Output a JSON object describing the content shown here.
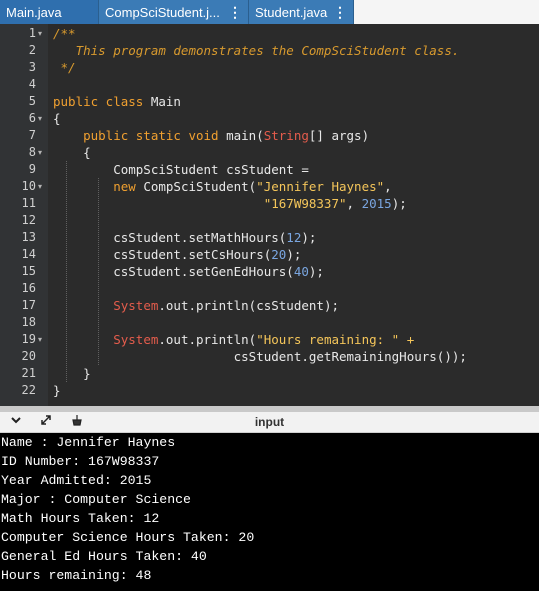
{
  "tabs": [
    {
      "label": "Main.java",
      "active": true
    },
    {
      "label": "CompSciStudent.j...",
      "menu": "⋮"
    },
    {
      "label": "Student.java",
      "menu": "⋮"
    }
  ],
  "editor": {
    "lines": [
      {
        "n": "1",
        "fold": "▾"
      },
      {
        "n": "2"
      },
      {
        "n": "3"
      },
      {
        "n": "4"
      },
      {
        "n": "5"
      },
      {
        "n": "6",
        "fold": "▾"
      },
      {
        "n": "7"
      },
      {
        "n": "8",
        "fold": "▾"
      },
      {
        "n": "9"
      },
      {
        "n": "10",
        "fold": "▾"
      },
      {
        "n": "11"
      },
      {
        "n": "12"
      },
      {
        "n": "13"
      },
      {
        "n": "14"
      },
      {
        "n": "15"
      },
      {
        "n": "16"
      },
      {
        "n": "17"
      },
      {
        "n": "18"
      },
      {
        "n": "19",
        "fold": "▾"
      },
      {
        "n": "20"
      },
      {
        "n": "21"
      },
      {
        "n": "22"
      }
    ],
    "code": {
      "l1": "/**",
      "l2": "   This program demonstrates the CompSciStudent class.",
      "l3": " */",
      "l5_kw": "public class",
      "l5_name": " Main",
      "l6": "{",
      "l7_kw": "    public static void",
      "l7_a": " main(",
      "l7_cls": "String",
      "l7_b": "[] args)",
      "l8": "    {",
      "l9": "        CompSciStudent csStudent =",
      "l10_kw": "        new",
      "l10_a": " CompSciStudent(",
      "l10_str": "\"Jennifer Haynes\"",
      "l10_b": ",",
      "l11_pad": "                            ",
      "l11_str": "\"167W98337\"",
      "l11_a": ", ",
      "l11_num": "2015",
      "l11_b": ");",
      "l13_a": "        csStudent.setMathHours(",
      "l13_num": "12",
      "l13_b": ");",
      "l14_a": "        csStudent.setCsHours(",
      "l14_num": "20",
      "l14_b": ");",
      "l15_a": "        csStudent.setGenEdHours(",
      "l15_num": "40",
      "l15_b": ");",
      "l17_pad": "        ",
      "l17_cls": "System",
      "l17_a": ".out.println(csStudent);",
      "l19_pad": "        ",
      "l19_cls": "System",
      "l19_a": ".out.println(",
      "l19_str": "\"Hours remaining: \" +",
      "l20": "                        csStudent.getRemainingHours());",
      "l21": "    }",
      "l22": "}"
    }
  },
  "console": {
    "title": "input",
    "output": [
      "Name : Jennifer Haynes",
      "ID Number: 167W98337",
      "Year Admitted: 2015",
      "Major : Computer Science",
      "Math Hours Taken: 12",
      "Computer Science Hours Taken: 20",
      "General Ed Hours Taken: 40",
      "Hours remaining: 48"
    ]
  },
  "icons": {
    "collapse": "chevron-down-icon",
    "expand": "expand-arrows-icon",
    "clear": "broom-icon"
  },
  "colors": {
    "tab_bg": "#3b7bb6",
    "editor_bg": "#2b2b2b",
    "keyword": "#f0a030",
    "string": "#f5c65a",
    "number": "#7aa6e0",
    "class": "#e45c4c",
    "console_bg": "#000000"
  }
}
